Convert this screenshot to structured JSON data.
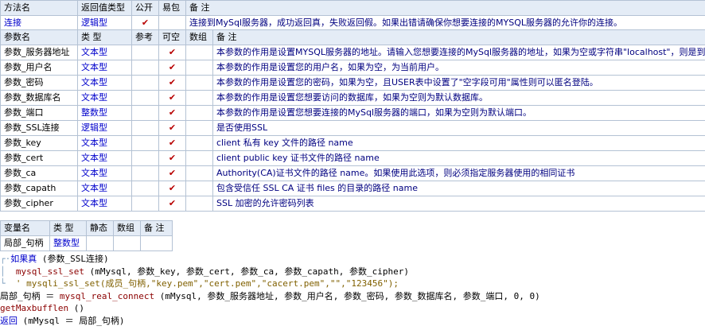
{
  "method_table": {
    "headers": [
      "方法名",
      "返回值类型",
      "公开",
      "易包",
      "备 注"
    ],
    "row": {
      "name": "连接",
      "return_type": "逻辑型",
      "public": "✔",
      "easy_pack": "",
      "note": "连接到MySql服务器，成功返回真，失败返回假。如果出错请确保你想要连接的MYSQL服务器的允许你的连接。"
    }
  },
  "params_table": {
    "headers": [
      "参数名",
      "类 型",
      "参考",
      "可空",
      "数组",
      "备 注"
    ],
    "rows": [
      {
        "name": "参数_服务器地址",
        "type": "文本型",
        "ref": "",
        "nullable": "✔",
        "array": "",
        "note": "本参数的作用是设置MYSQL服务器的地址。请输入您想要连接的MySql服务器的地址，如果为空或字符串\"localhost\"，则是到本地服务器的连接。"
      },
      {
        "name": "参数_用户名",
        "type": "文本型",
        "ref": "",
        "nullable": "✔",
        "array": "",
        "note": "本参数的作用是设置您的用户名，如果为空，为当前用户。"
      },
      {
        "name": "参数_密码",
        "type": "文本型",
        "ref": "",
        "nullable": "✔",
        "array": "",
        "note": "本参数的作用是设置您的密码，如果为空，且USER表中设置了\"空字段可用\"属性则可以匿名登陆。"
      },
      {
        "name": "参数_数据库名",
        "type": "文本型",
        "ref": "",
        "nullable": "✔",
        "array": "",
        "note": "本参数的作用是设置您想要访问的数据库，如果为空则为默认数据库。"
      },
      {
        "name": "参数_端口",
        "type": "整数型",
        "ref": "",
        "nullable": "✔",
        "array": "",
        "note": "本参数的作用是设置您想要连接的MySql服务器的端口，如果为空则为默认端口。"
      },
      {
        "name": "参数_SSL连接",
        "type": "逻辑型",
        "ref": "",
        "nullable": "✔",
        "array": "",
        "note": "是否使用SSL"
      },
      {
        "name": "参数_key",
        "type": "文本型",
        "ref": "",
        "nullable": "✔",
        "array": "",
        "note": "client 私有 key 文件的路径 name"
      },
      {
        "name": "参数_cert",
        "type": "文本型",
        "ref": "",
        "nullable": "✔",
        "array": "",
        "note": "client public key 证书文件的路径 name"
      },
      {
        "name": "参数_ca",
        "type": "文本型",
        "ref": "",
        "nullable": "✔",
        "array": "",
        "note": "Authority(CA)证书文件的路径 name。如果使用此选项，则必须指定服务器使用的相同证书"
      },
      {
        "name": "参数_capath",
        "type": "文本型",
        "ref": "",
        "nullable": "✔",
        "array": "",
        "note": "包含受信任 SSL CA 证书 files 的目录的路径 name"
      },
      {
        "name": "参数_cipher",
        "type": "文本型",
        "ref": "",
        "nullable": "✔",
        "array": "",
        "note": "SSL 加密的允许密码列表"
      }
    ]
  },
  "vars_table": {
    "headers": [
      "变量名",
      "类 型",
      "静态",
      "数组",
      "备 注"
    ],
    "rows": [
      {
        "name": "局部_句柄",
        "type": "整数型",
        "static": "",
        "array": "",
        "note": ""
      }
    ]
  },
  "code": {
    "line1_kw": "如果真",
    "line1_rest": " (参数_SSL连接)",
    "line2_fn": "mysql_ssl_set",
    "line2_rest": " (mMysql, 参数_key, 参数_cert, 参数_ca, 参数_capath, 参数_cipher)",
    "line3": "' mysqli_ssl_set(成员_句柄,\"key.pem\",\"cert.pem\",\"cacert.pem\",\"\",\"123456\");",
    "line4_a": "局部_句柄 ＝ ",
    "line4_fn": "mysql_real_connect",
    "line4_rest": " (mMysql, 参数_服务器地址, 参数_用户名, 参数_密码, 参数_数据库名, 参数_端口, 0, 0)",
    "line5_fn": "getMaxbufflen",
    "line5_rest": " ()",
    "line6_kw": "返回",
    "line6_rest": " (mMysql ＝ 局部_句柄)"
  }
}
